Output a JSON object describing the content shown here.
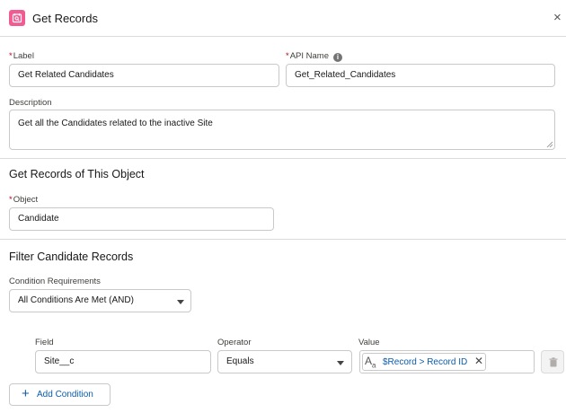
{
  "header": {
    "title": "Get Records",
    "icon": "get-records-icon",
    "close_icon": "close-icon"
  },
  "general": {
    "label": {
      "label": "Label",
      "required_marker": "*",
      "value": "Get Related Candidates"
    },
    "api_name": {
      "label": "API Name",
      "required_marker": "*",
      "info_icon": "i",
      "value": "Get_Related_Candidates"
    },
    "description": {
      "label": "Description",
      "value": "Get all the Candidates related to the inactive Site"
    }
  },
  "object_section": {
    "title": "Get Records of This Object",
    "object": {
      "label": "Object",
      "required_marker": "*",
      "value": "Candidate"
    }
  },
  "filter_section": {
    "title": "Filter Candidate Records",
    "condition_requirements": {
      "label": "Condition Requirements",
      "value": "All Conditions Are Met (AND)"
    },
    "columns": {
      "field": "Field",
      "operator": "Operator",
      "value": "Value"
    },
    "conditions": [
      {
        "field": "Site__c",
        "operator": "Equals",
        "value": {
          "type_icon_main": "A",
          "type_icon_sub": "a",
          "text": "$Record > Record ID",
          "remove": "✕"
        }
      }
    ],
    "add_condition": {
      "plus": "+",
      "label": "Add Condition"
    }
  },
  "colors": {
    "brand_pink": "#f25b92",
    "link_blue": "#0b5cab",
    "required_red": "#ba0517",
    "border": "#c9c9c9"
  }
}
